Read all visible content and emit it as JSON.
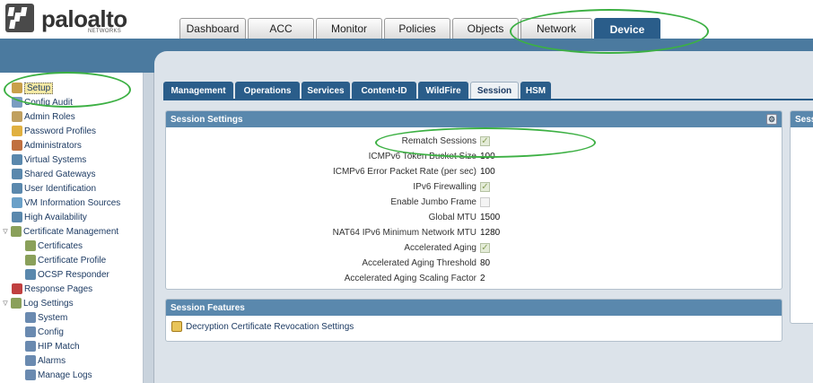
{
  "brand": {
    "name": "paloalto",
    "sub": "NETWORKS"
  },
  "main_tabs": [
    {
      "label": "Dashboard",
      "active": false
    },
    {
      "label": "ACC",
      "active": false
    },
    {
      "label": "Monitor",
      "active": false
    },
    {
      "label": "Policies",
      "active": false
    },
    {
      "label": "Objects",
      "active": false
    },
    {
      "label": "Network",
      "active": false
    },
    {
      "label": "Device",
      "active": true
    }
  ],
  "sidebar": {
    "items": [
      {
        "label": "Setup",
        "icon": "setup-icon",
        "indent": 0,
        "selected": true
      },
      {
        "label": "Config Audit",
        "icon": "config-audit-icon",
        "indent": 0
      },
      {
        "label": "Admin Roles",
        "icon": "admin-roles-icon",
        "indent": 0
      },
      {
        "label": "Password Profiles",
        "icon": "password-profiles-icon",
        "indent": 0
      },
      {
        "label": "Administrators",
        "icon": "administrators-icon",
        "indent": 0
      },
      {
        "label": "Virtual Systems",
        "icon": "virtual-systems-icon",
        "indent": 0
      },
      {
        "label": "Shared Gateways",
        "icon": "shared-gateways-icon",
        "indent": 0
      },
      {
        "label": "User Identification",
        "icon": "user-identification-icon",
        "indent": 0
      },
      {
        "label": "VM Information Sources",
        "icon": "vm-sources-icon",
        "indent": 0
      },
      {
        "label": "High Availability",
        "icon": "high-availability-icon",
        "indent": 0
      },
      {
        "label": "Certificate Management",
        "icon": "certificate-management-icon",
        "indent": 0,
        "expand": true
      },
      {
        "label": "Certificates",
        "icon": "certificates-icon",
        "indent": 1
      },
      {
        "label": "Certificate Profile",
        "icon": "certificate-profile-icon",
        "indent": 1
      },
      {
        "label": "OCSP Responder",
        "icon": "ocsp-responder-icon",
        "indent": 1
      },
      {
        "label": "Response Pages",
        "icon": "response-pages-icon",
        "indent": 0
      },
      {
        "label": "Log Settings",
        "icon": "log-settings-icon",
        "indent": 0,
        "expand": true
      },
      {
        "label": "System",
        "icon": "system-log-icon",
        "indent": 1
      },
      {
        "label": "Config",
        "icon": "config-log-icon",
        "indent": 1
      },
      {
        "label": "HIP Match",
        "icon": "hip-match-icon",
        "indent": 1
      },
      {
        "label": "Alarms",
        "icon": "alarms-icon",
        "indent": 1
      },
      {
        "label": "Manage Logs",
        "icon": "manage-logs-icon",
        "indent": 1
      }
    ]
  },
  "sub_tabs": [
    {
      "label": "Management",
      "active": false
    },
    {
      "label": "Operations",
      "active": false
    },
    {
      "label": "Services",
      "active": false
    },
    {
      "label": "Content-ID",
      "active": false
    },
    {
      "label": "WildFire",
      "active": false
    },
    {
      "label": "Session",
      "active": true
    },
    {
      "label": "HSM",
      "active": false
    }
  ],
  "session_settings": {
    "title": "Session Settings",
    "rows": [
      {
        "label": "Rematch Sessions",
        "type": "check",
        "checked": true
      },
      {
        "label": "ICMPv6 Token Bucket Size",
        "type": "value",
        "value": "100"
      },
      {
        "label": "ICMPv6 Error Packet Rate (per sec)",
        "type": "value",
        "value": "100"
      },
      {
        "label": "IPv6 Firewalling",
        "type": "check",
        "checked": true
      },
      {
        "label": "Enable Jumbo Frame",
        "type": "check",
        "checked": false
      },
      {
        "label": "Global MTU",
        "type": "value",
        "value": "1500"
      },
      {
        "label": "NAT64 IPv6 Minimum Network MTU",
        "type": "value",
        "value": "1280"
      },
      {
        "label": "Accelerated Aging",
        "type": "check",
        "checked": true
      },
      {
        "label": "Accelerated Aging Threshold",
        "type": "value",
        "value": "80"
      },
      {
        "label": "Accelerated Aging Scaling Factor",
        "type": "value",
        "value": "2"
      }
    ]
  },
  "session_features": {
    "title": "Session Features",
    "link": "Decryption Certificate Revocation Settings"
  },
  "right_panel": {
    "title": "Sess"
  },
  "colors": {
    "accent": "#2a5d8a",
    "panel_head": "#5a88ad",
    "highlight": "#3cb043"
  }
}
